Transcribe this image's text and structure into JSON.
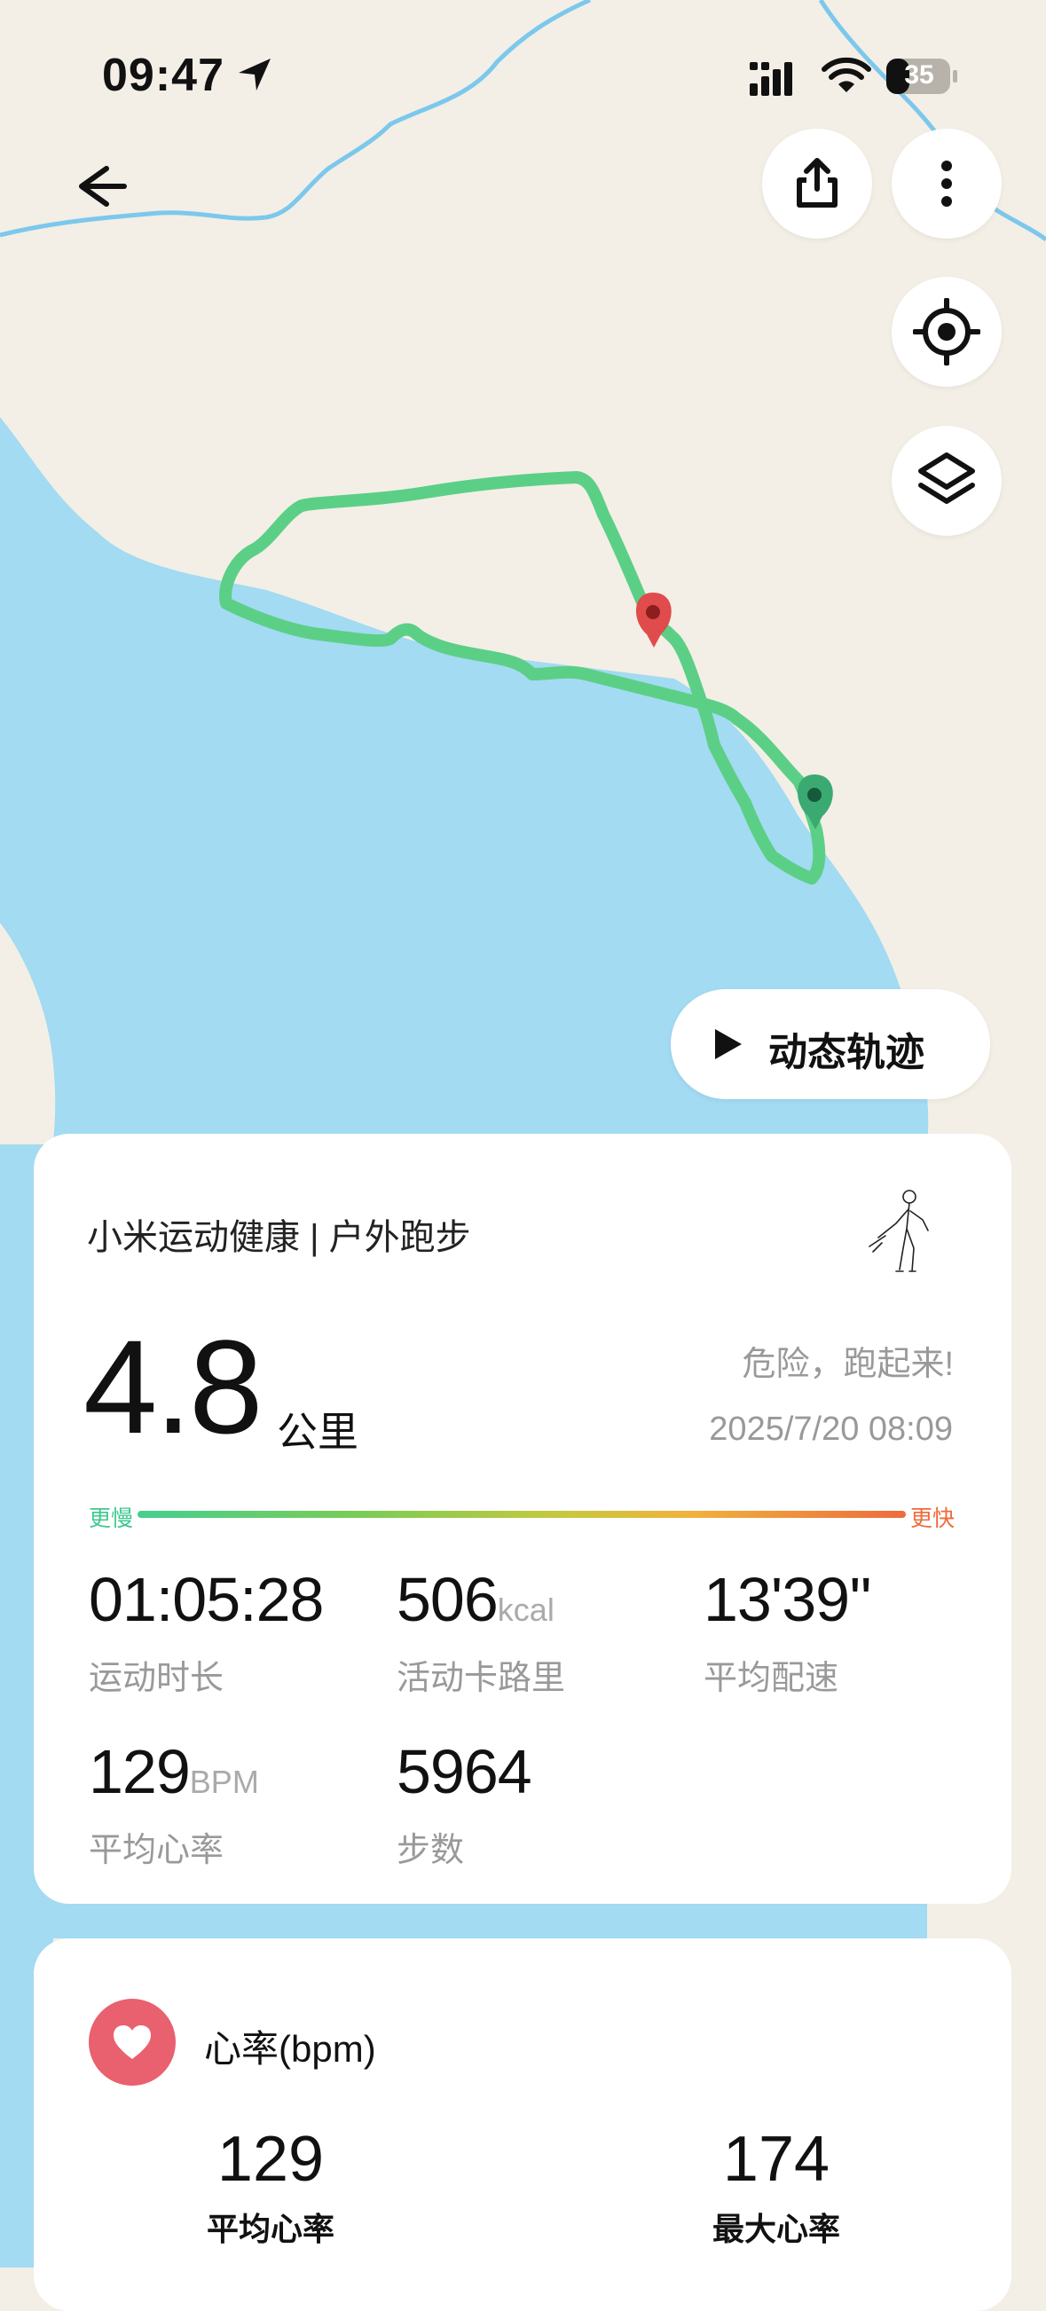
{
  "status_bar": {
    "time": "09:47",
    "battery": "35"
  },
  "map": {
    "colors": {
      "land": "#f3efe6",
      "water": "#a2dbf2",
      "river": "#7cc8ec",
      "track": "#5ccf86",
      "start_pin": "#3aaa72",
      "end_pin": "#e04b4b"
    }
  },
  "map_controls": {
    "replay_label": "动态轨迹"
  },
  "summary": {
    "app_title": "小米运动健康 | 户外跑步",
    "distance": "4.8",
    "distance_unit": "公里",
    "slogan": "危险，跑起来!",
    "datetime": "2025/7/20 08:09",
    "pace_bar": {
      "slow_label": "更慢",
      "fast_label": "更快"
    },
    "stats": [
      {
        "value": "01:05:28",
        "unit": "",
        "label": "运动时长"
      },
      {
        "value": "506",
        "unit": "kcal",
        "label": "活动卡路里"
      },
      {
        "value": "13'39''",
        "unit": "",
        "label": "平均配速"
      },
      {
        "value": "129",
        "unit": "BPM",
        "label": "平均心率"
      },
      {
        "value": "5964",
        "unit": "",
        "label": "步数"
      }
    ]
  },
  "heart_rate": {
    "title": "心率(bpm)",
    "avg_value": "129",
    "avg_label": "平均心率",
    "max_value": "174",
    "max_label": "最大心率"
  }
}
